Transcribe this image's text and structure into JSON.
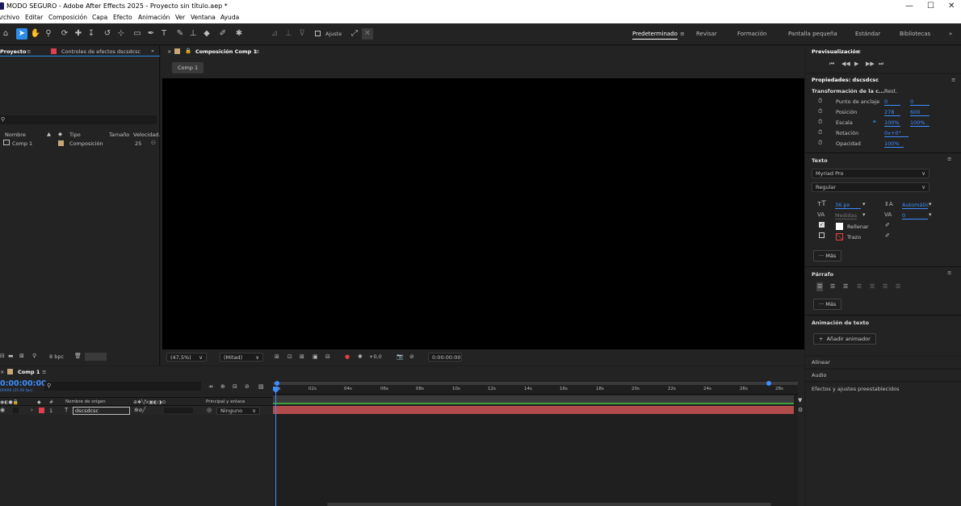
{
  "window": {
    "title": "MODO SEGURO - Adobe After Effects 2025 - Proyecto sin título.aep *"
  },
  "menu": [
    "Archivo",
    "Editar",
    "Composición",
    "Capa",
    "Efecto",
    "Animación",
    "Ver",
    "Ventana",
    "Ayuda"
  ],
  "toolbar": {
    "ajuste_label": "Ajuste",
    "workspaces": [
      "Predeterminado",
      "Revisar",
      "Formación",
      "Pantalla pequeña",
      "Estándar",
      "Bibliotecas"
    ],
    "active_workspace_menu": "≡"
  },
  "project_panel": {
    "tab_project": "Proyecto",
    "tab_effects": "Controles de efectos dscsdcsc",
    "columns": [
      "Nombre",
      "Tipo",
      "Tamaño",
      "Velocidad..."
    ],
    "items": [
      {
        "name": "Comp 1",
        "type": "Composición",
        "size": "",
        "fps": "25"
      }
    ],
    "bpc_label": "8 bpc"
  },
  "composition_panel": {
    "tab": "Composición Comp 1",
    "subtab": "Comp 1",
    "zoom": "(47,5%)",
    "resolution": "(Mitad)",
    "exposure": "+0,0",
    "timecode": "0:00:00:00"
  },
  "preview": {
    "title": "Previsualización"
  },
  "properties": {
    "title": "Propiedades: dscsdcsc",
    "transform_label": "Transformación de la c...",
    "reset": "Rest.",
    "rows": [
      {
        "label": "Punto de anclaje",
        "v1": "0",
        "v2": "0"
      },
      {
        "label": "Posición",
        "v1": "278",
        "v2": "600"
      },
      {
        "label": "Escala",
        "v1": "100%",
        "v2": "100%"
      },
      {
        "label": "Rotación",
        "v1": "0x+0°",
        "v2": ""
      },
      {
        "label": "Opacidad",
        "v1": "100%",
        "v2": ""
      }
    ]
  },
  "text": {
    "title": "Texto",
    "font": "Myriad Pro",
    "style": "Regular",
    "size": "36 px",
    "leading": "Automátic",
    "kerning": "Medidas",
    "tracking": "0",
    "fill_label": "Rellenar",
    "stroke_label": "Trazo",
    "more": "Más"
  },
  "paragraph": {
    "title": "Párrafo",
    "more": "Más"
  },
  "text_animation": {
    "title": "Animación de texto",
    "add_button": "Añadir animador"
  },
  "collapsed_panels": [
    "Alinear",
    "Audio",
    "Efectos y ajustes preestablecidos"
  ],
  "timeline": {
    "tab": "Comp 1",
    "timecode": "0:00:00:00",
    "frame_info": "00000 (25.00 fps)",
    "col_source": "Nombre de origen",
    "col_parent": "Principal y enlace",
    "ruler": [
      "0s",
      "02s",
      "04s",
      "06s",
      "08s",
      "10s",
      "12s",
      "14s",
      "16s",
      "18s",
      "20s",
      "22s",
      "24s",
      "26s",
      "28s"
    ],
    "layers": [
      {
        "index": "1",
        "name": "dscsdcsc",
        "parent": "Ninguno"
      }
    ]
  },
  "colors": {
    "accent": "#3f8cff",
    "layer_bar": "#b24b4b",
    "label_red": "#e0404e",
    "comp_tag": "#c8a774",
    "stroke_red": "#e04040"
  }
}
